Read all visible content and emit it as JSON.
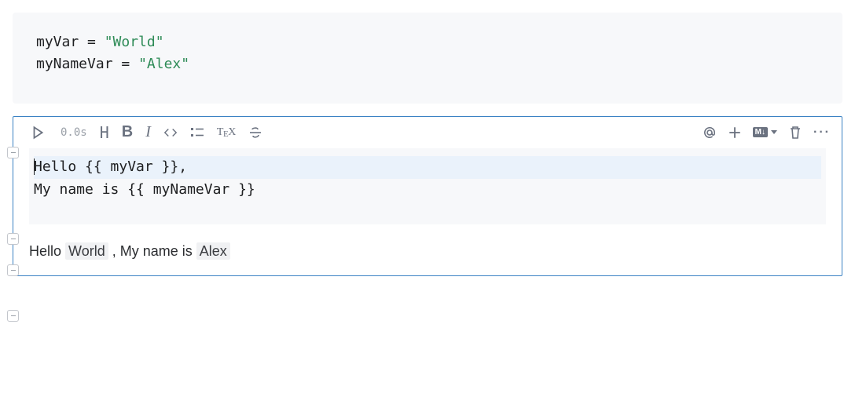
{
  "code_cell": {
    "lines": [
      {
        "var": "myVar",
        "op": " = ",
        "str": "\"World\""
      },
      {
        "var": "myNameVar",
        "op": " = ",
        "str": "\"Alex\""
      }
    ]
  },
  "toolbar": {
    "run_time": "0.0s",
    "tooltips": {
      "run": "run",
      "heading": "heading",
      "bold": "bold",
      "italic": "italic",
      "code": "code",
      "list": "list",
      "tex": "TeX",
      "strike": "strikethrough",
      "at": "at",
      "add": "add",
      "md": "M↓",
      "delete": "delete",
      "more": "more"
    }
  },
  "md_source": {
    "line1": "Hello {{ myVar }},",
    "line2": "My name is {{ myNameVar }}"
  },
  "md_output": {
    "pre1": "Hello ",
    "var1": "World",
    "mid": " , My name is ",
    "var2": "Alex"
  }
}
